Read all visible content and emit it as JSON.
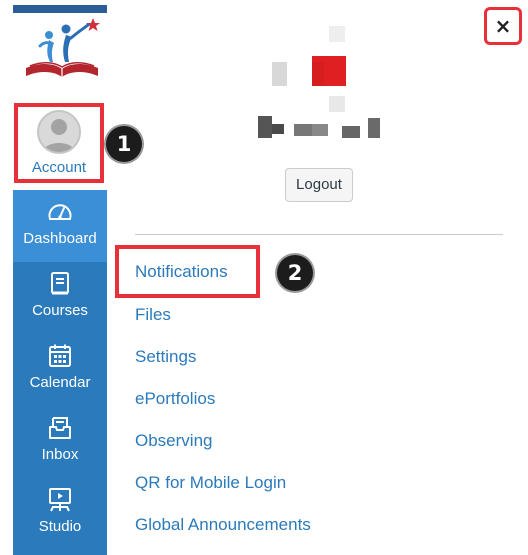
{
  "nav": {
    "account_label": "Account",
    "items": [
      {
        "label": "Dashboard",
        "icon": "dashboard-icon",
        "active": true
      },
      {
        "label": "Courses",
        "icon": "courses-icon",
        "active": false
      },
      {
        "label": "Calendar",
        "icon": "calendar-icon",
        "active": false
      },
      {
        "label": "Inbox",
        "icon": "inbox-icon",
        "active": false
      },
      {
        "label": "Studio",
        "icon": "studio-icon",
        "active": false
      }
    ]
  },
  "annotations": {
    "step1": "1",
    "step2": "2"
  },
  "tray": {
    "close_label": "×",
    "logout_label": "Logout",
    "links": [
      "Notifications",
      "Files",
      "Settings",
      "ePortfolios",
      "Observing",
      "QR for Mobile Login",
      "Global Announcements"
    ]
  },
  "colors": {
    "nav_blue": "#2b7abc",
    "nav_active": "#3a8fd6",
    "highlight_red": "#e8303a",
    "link_blue": "#2b7abc"
  }
}
